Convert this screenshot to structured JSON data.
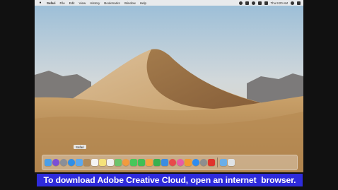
{
  "menubar": {
    "app_name": "Safari",
    "items": [
      "File",
      "Edit",
      "View",
      "History",
      "Bookmarks",
      "Window",
      "Help"
    ],
    "clock": "Thu 9:20 AM"
  },
  "dock": {
    "hover_tooltip": "Safari",
    "apps": [
      {
        "name": "finder",
        "color": "#4b9fe8"
      },
      {
        "name": "siri",
        "color": "#7b4fd6"
      },
      {
        "name": "launchpad",
        "color": "#8a8f99"
      },
      {
        "name": "safari",
        "color": "#2f8fe8"
      },
      {
        "name": "mail",
        "color": "#5aa8f0"
      },
      {
        "name": "contacts",
        "color": "#b08a5a"
      },
      {
        "name": "calendar",
        "color": "#f4f4f4"
      },
      {
        "name": "notes",
        "color": "#f5e27a"
      },
      {
        "name": "reminders",
        "color": "#f0f0f0"
      },
      {
        "name": "maps",
        "color": "#6cc36a"
      },
      {
        "name": "photos",
        "color": "#f29b3e"
      },
      {
        "name": "messages",
        "color": "#48c75a"
      },
      {
        "name": "facetime",
        "color": "#3fbf55"
      },
      {
        "name": "pages",
        "color": "#f4a340"
      },
      {
        "name": "numbers",
        "color": "#3ab04f"
      },
      {
        "name": "keynote",
        "color": "#3c8de0"
      },
      {
        "name": "news",
        "color": "#e84a4a"
      },
      {
        "name": "itunes",
        "color": "#e95ba6"
      },
      {
        "name": "ibooks",
        "color": "#f39a2e"
      },
      {
        "name": "app-store",
        "color": "#2d8cf0"
      },
      {
        "name": "system-preferences",
        "color": "#8e8e8e"
      },
      {
        "name": "creative-cloud",
        "color": "#e0342c"
      }
    ],
    "trailing": [
      {
        "name": "downloads",
        "color": "#6aaee8"
      },
      {
        "name": "trash",
        "color": "#dfe3e6"
      }
    ]
  },
  "caption": "To download Adobe Creative Cloud, open an internet  browser."
}
